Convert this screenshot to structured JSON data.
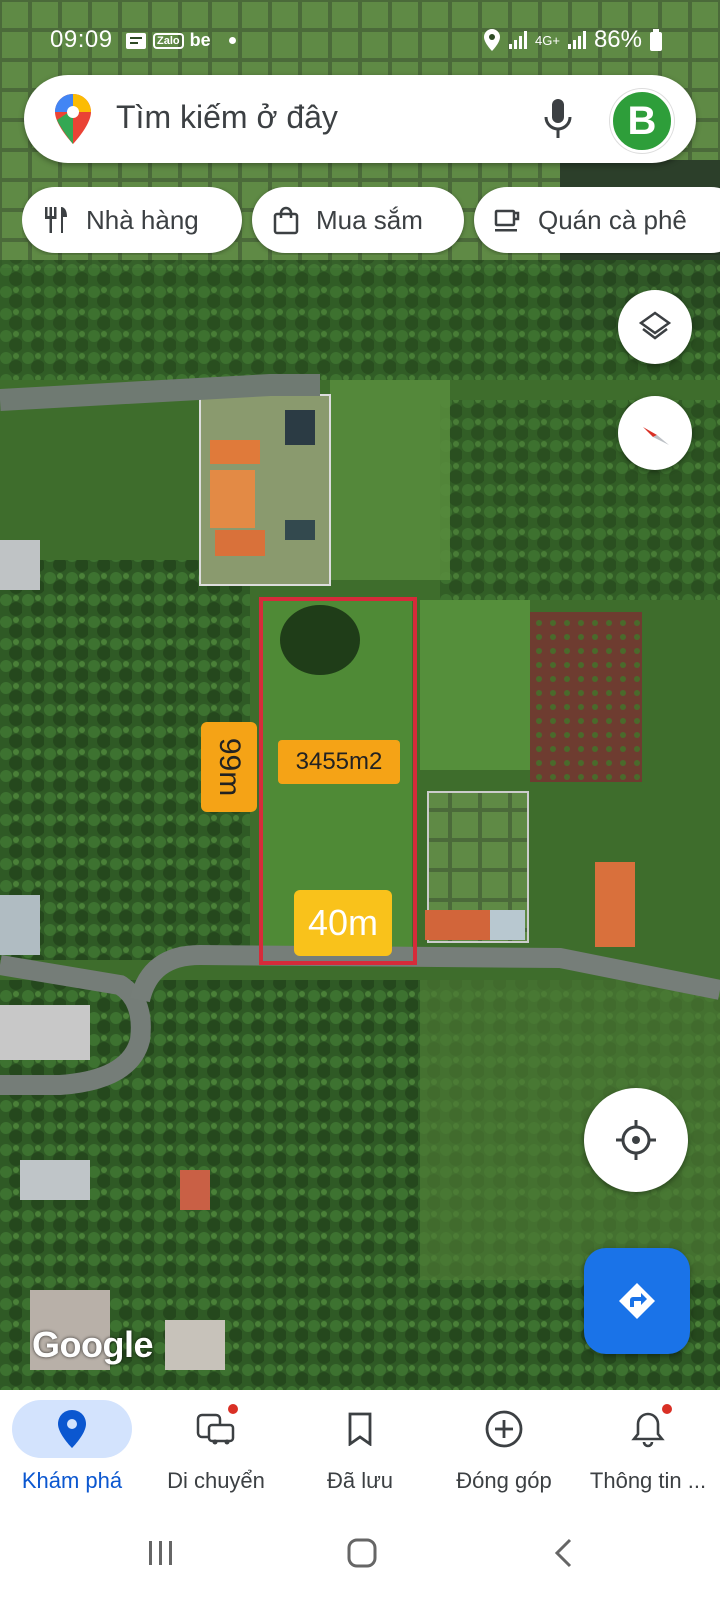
{
  "status_bar": {
    "time": "09:09",
    "app_icons": [
      "message-icon",
      "zalo-icon",
      "be-icon"
    ],
    "zalo": "Zalo",
    "be": "be",
    "network": "4G+",
    "battery": "86%"
  },
  "search": {
    "placeholder": "Tìm kiếm ở đây",
    "avatar_letter": "B",
    "avatar_color": "#2e9e3a"
  },
  "chips": [
    {
      "label": "Nhà hàng",
      "icon": "restaurant-icon"
    },
    {
      "label": "Mua sắm",
      "icon": "shopping-bag-icon"
    },
    {
      "label": "Quán cà phê",
      "icon": "coffee-icon"
    }
  ],
  "map": {
    "area_label": "3455m2",
    "side_label": "99m",
    "front_label": "40m",
    "watermark": "Google",
    "plot_outline_color": "#d62b3a"
  },
  "bottom_nav": [
    {
      "label": "Khám phá",
      "icon": "explore-pin-icon",
      "active": true
    },
    {
      "label": "Di chuyển",
      "icon": "commute-icon",
      "badge": true
    },
    {
      "label": "Đã lưu",
      "icon": "bookmark-icon"
    },
    {
      "label": "Đóng góp",
      "icon": "add-circle-icon"
    },
    {
      "label": "Thông tin ...",
      "icon": "bell-icon",
      "badge": true
    }
  ],
  "colors": {
    "accent": "#1a73e8",
    "active_nav_bg": "#d3e3fd",
    "label_orange": "#f5a316"
  }
}
